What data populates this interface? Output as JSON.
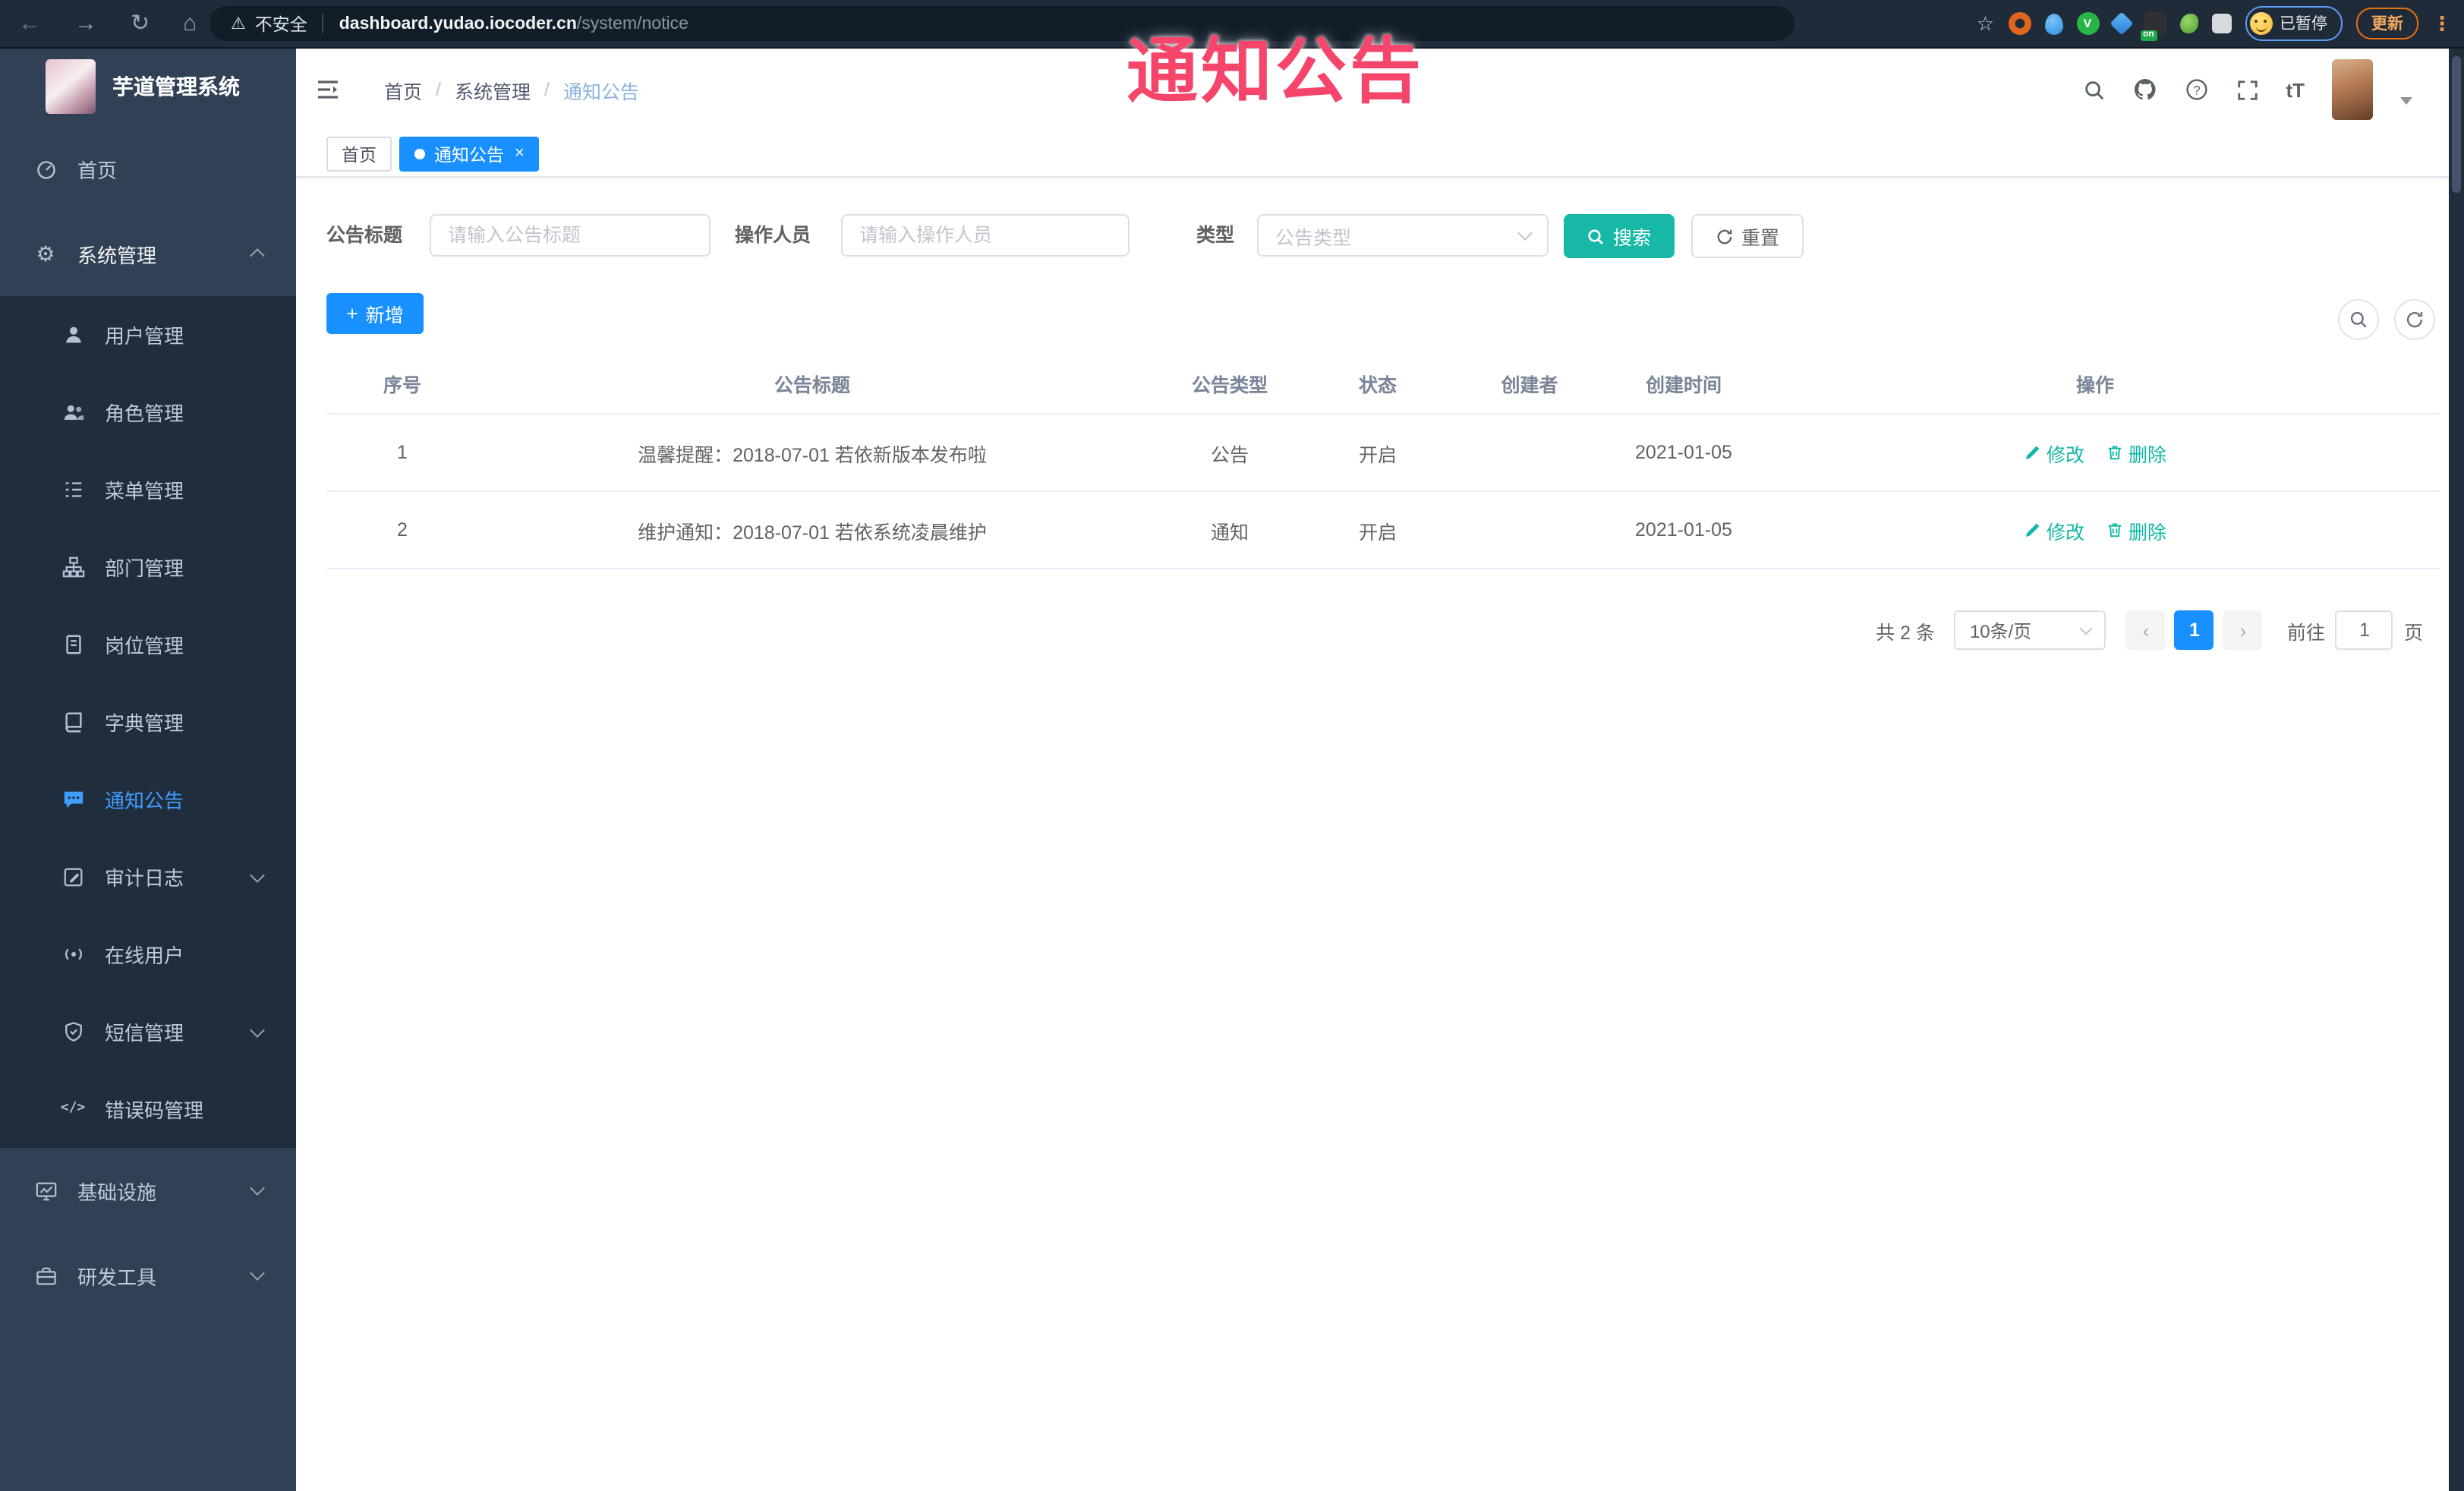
{
  "annotation": {
    "label": "通知公告"
  },
  "browser": {
    "security_label": "不安全",
    "url_host": "dashboard.yudao.iocoder.cn",
    "url_path": "/system/notice",
    "extension_badge": "on",
    "profile_status": "已暂停",
    "update_label": "更新"
  },
  "sidebar": {
    "app_title": "芋道管理系统",
    "items": [
      {
        "label": "首页"
      },
      {
        "label": "系统管理"
      },
      {
        "label": "用户管理"
      },
      {
        "label": "角色管理"
      },
      {
        "label": "菜单管理"
      },
      {
        "label": "部门管理"
      },
      {
        "label": "岗位管理"
      },
      {
        "label": "字典管理"
      },
      {
        "label": "通知公告"
      },
      {
        "label": "审计日志"
      },
      {
        "label": "在线用户"
      },
      {
        "label": "短信管理"
      },
      {
        "label": "错误码管理"
      },
      {
        "label": "基础设施"
      },
      {
        "label": "研发工具"
      }
    ]
  },
  "header": {
    "breadcrumb": [
      "首页",
      "系统管理",
      "通知公告"
    ]
  },
  "tabs": [
    {
      "label": "首页"
    },
    {
      "label": "通知公告"
    }
  ],
  "filters": {
    "title_label": "公告标题",
    "title_placeholder": "请输入公告标题",
    "operator_label": "操作人员",
    "operator_placeholder": "请输入操作人员",
    "type_label": "类型",
    "type_placeholder": "公告类型",
    "search_label": "搜索",
    "reset_label": "重置"
  },
  "toolbar": {
    "add_label": "新增"
  },
  "table": {
    "columns": [
      "序号",
      "公告标题",
      "公告类型",
      "状态",
      "创建者",
      "创建时间",
      "操作"
    ],
    "rows": [
      {
        "no": "1",
        "title": "温馨提醒：2018-07-01 若依新版本发布啦",
        "type": "公告",
        "status": "开启",
        "creator": "",
        "created": "2021-01-05",
        "edit_label": "修改",
        "delete_label": "删除"
      },
      {
        "no": "2",
        "title": "维护通知：2018-07-01 若依系统凌晨维护",
        "type": "通知",
        "status": "开启",
        "creator": "",
        "created": "2021-01-05",
        "edit_label": "修改",
        "delete_label": "删除"
      }
    ]
  },
  "pagination": {
    "total_label": "共 2 条",
    "page_size_label": "10条/页",
    "current_page": "1",
    "goto_label": "前往",
    "goto_value": "1",
    "unit_label": "页"
  },
  "colors": {
    "primary_blue": "#1890ff",
    "active_menu_blue": "#409eff",
    "sidebar_bg": "#304156",
    "submenu_bg": "#1f2d3d",
    "search_button_teal": "#17b8a6",
    "action_link_teal": "#13b8a8",
    "annotation_red": "#f5456b"
  }
}
